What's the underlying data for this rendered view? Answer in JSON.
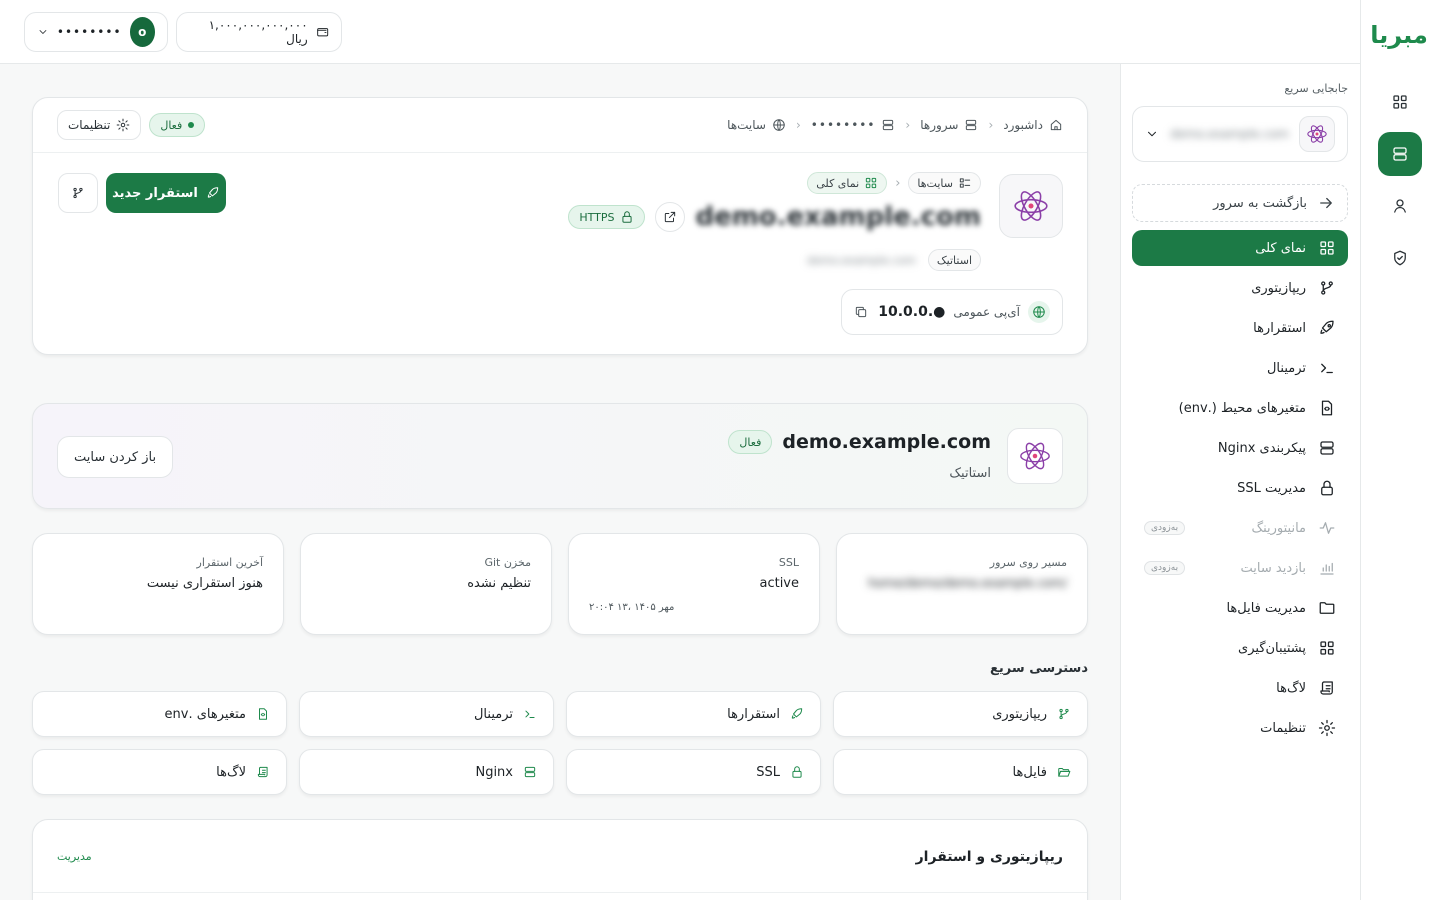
{
  "brand": {
    "logo_text": "مبریا"
  },
  "topbar": {
    "balance": "۱,۰۰۰,۰۰۰,۰۰۰,۰۰۰ ریال",
    "user_masked": "••••••••",
    "avatar_letter": "o"
  },
  "sidebar": {
    "quick_switch_label": "جابجایی سریع",
    "quick_switch_value": "demo.example.com",
    "back_label": "بازگشت به سرور",
    "items": [
      {
        "label": "نمای کلی",
        "icon": "grid-icon"
      },
      {
        "label": "ریپازیتوری",
        "icon": "git-branch-icon"
      },
      {
        "label": "استقرارها",
        "icon": "rocket-icon"
      },
      {
        "label": "ترمینال",
        "icon": "terminal-icon"
      },
      {
        "label": "متغیرهای محیط (.env)",
        "icon": "env-file-icon"
      },
      {
        "label": "پیکربندی Nginx",
        "icon": "server-icon"
      },
      {
        "label": "مدیریت SSL",
        "icon": "lock-icon"
      },
      {
        "label": "مانیتورینگ",
        "icon": "activity-icon",
        "soon": "به‌زودی"
      },
      {
        "label": "بازدید سایت",
        "icon": "bar-chart-icon",
        "soon": "به‌زودی"
      },
      {
        "label": "مدیریت فایل‌ها",
        "icon": "folder-icon"
      },
      {
        "label": "پشتیبان‌گیری",
        "icon": "backup-icon"
      },
      {
        "label": "لاگ‌ها",
        "icon": "scroll-icon"
      },
      {
        "label": "تنظیمات",
        "icon": "gear-icon"
      }
    ]
  },
  "breadcrumb": {
    "items": [
      "داشبورد",
      "سرورها",
      "••••••••",
      "سایت‌ها"
    ],
    "status": "فعال",
    "settings_label": "تنظیمات"
  },
  "header": {
    "sub_crumbs": [
      "سایت‌ها",
      "نمای کلی"
    ],
    "domain": "demo.example.com",
    "https_label": "HTTPS",
    "type_chip": "استاتیک",
    "blurred_sub": "demo.example.com",
    "public_ip_label": "آی‌پی عمومی",
    "public_ip_value": "10.0.0.●",
    "deploy_button": "استقرار جدید"
  },
  "banner": {
    "domain": "demo.example.com",
    "status": "فعال",
    "type": "استاتیک",
    "open_button": "باز کردن سایت"
  },
  "stats": [
    {
      "label": "مسیر روی سرور",
      "value": "/home/demo/demo.example.com",
      "blurred": true
    },
    {
      "label": "SSL",
      "value": "active",
      "sub": "مهر ۱۴۰۵ ،۱۳ ۲۰:۰۴"
    },
    {
      "label": "مخزن Git",
      "value": "تنظیم نشده"
    },
    {
      "label": "آخرین استقرار",
      "value": "هنوز استقراری نیست"
    }
  ],
  "quick_access": {
    "title": "دسترسی سریع",
    "items": [
      {
        "label": "ریپازیتوری",
        "icon": "git-branch-icon"
      },
      {
        "label": "استقرارها",
        "icon": "rocket-icon"
      },
      {
        "label": "ترمینال",
        "icon": "terminal-icon"
      },
      {
        "label": "متغیرهای .env",
        "icon": "env-file-icon"
      },
      {
        "label": "فایل‌ها",
        "icon": "folder-open-icon"
      },
      {
        "label": "SSL",
        "icon": "lock-icon"
      },
      {
        "label": "Nginx",
        "icon": "server-icon"
      },
      {
        "label": "لاگ‌ها",
        "icon": "scroll-icon"
      }
    ]
  },
  "repo_section": {
    "title": "ریپازیتوری و استقرار",
    "manage_link": "مدیریت"
  },
  "colors": {
    "accent": "#1c7a46",
    "accent_light": "#e6f5ec",
    "react": "#8b3fa8"
  }
}
